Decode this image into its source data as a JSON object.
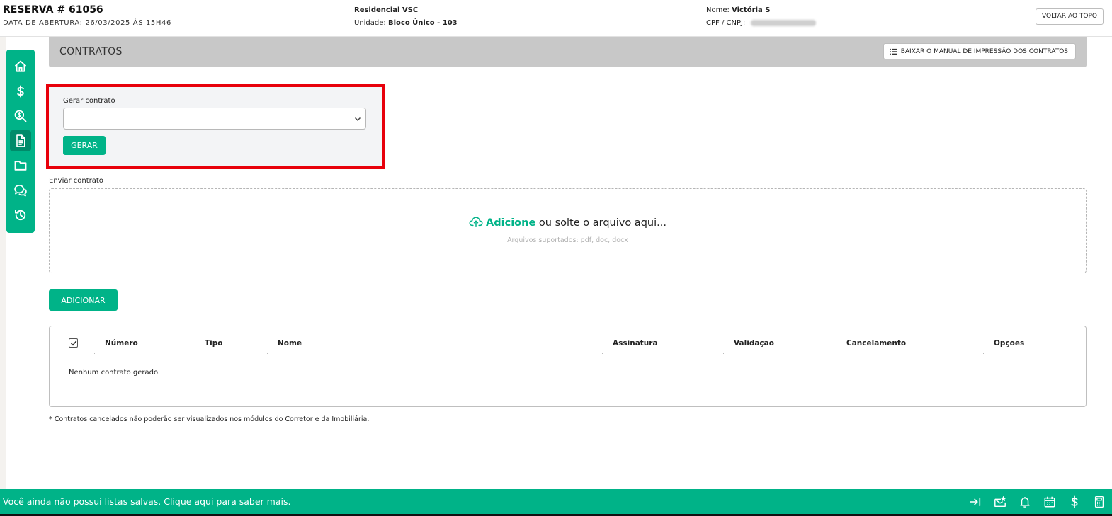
{
  "header": {
    "reservation_title": "RESERVA # 61056",
    "opening_date": "DATA DE ABERTURA: 26/03/2025 ÀS 15H46",
    "project_name": "Residencial VSC",
    "unit_label": "Unidade:",
    "unit_value": "Bloco Único - 103",
    "client_name_label": "Nome:",
    "client_name_value": "Victória S",
    "client_doc_label": "CPF / CNPJ:",
    "back_to_top_label": "VOLTAR AO TOPO"
  },
  "sidebar": {
    "items": [
      {
        "icon": "home-icon"
      },
      {
        "icon": "dollar-icon"
      },
      {
        "icon": "search-dollar-icon"
      },
      {
        "icon": "document-icon",
        "active": true
      },
      {
        "icon": "folder-icon"
      },
      {
        "icon": "chat-icon"
      },
      {
        "icon": "history-icon"
      }
    ]
  },
  "section": {
    "title": "CONTRATOS",
    "manual_button_label": "BAIXAR O MANUAL DE IMPRESSÃO DOS CONTRATOS"
  },
  "generate": {
    "label": "Gerar contrato",
    "select_value": "",
    "button_label": "GERAR"
  },
  "upload": {
    "label": "Enviar contrato",
    "add_link": "Adicione",
    "drop_text": " ou solte o arquivo aqui...",
    "supported": "Arquivos suportados: pdf, doc, docx",
    "add_button_label": "ADICIONAR"
  },
  "table": {
    "columns": [
      "Número",
      "Tipo",
      "Nome",
      "Assinatura",
      "Validação",
      "Cancelamento",
      "Opções"
    ],
    "empty_message": "Nenhum contrato gerado."
  },
  "footnote": "* Contratos cancelados não poderão ser visualizados nos módulos do Corretor e da Imobiliária.",
  "bottombar": {
    "message": "Você ainda não possui listas salvas. Clique aqui para saber mais.",
    "icons": [
      "collapse-right-icon",
      "mail-star-icon",
      "bell-icon",
      "calendar-icon",
      "dollar-icon",
      "calculator-icon"
    ]
  },
  "colors": {
    "accent": "#00b388",
    "highlight": "#e8000b",
    "section_bar": "#c8c8c8"
  }
}
